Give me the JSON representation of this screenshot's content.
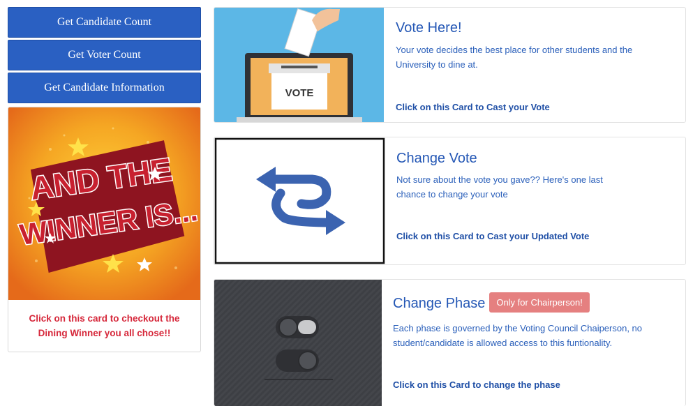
{
  "sidebar": {
    "buttons": [
      {
        "label": "Get Candidate Count"
      },
      {
        "label": "Get Voter Count"
      },
      {
        "label": "Get Candidate Information"
      }
    ],
    "winner_card": {
      "image_text": "AND THE WINNER IS...",
      "caption_line1": "Click on this card to checkout the",
      "caption_line2": "Dining Winner you all chose!!"
    }
  },
  "cards": [
    {
      "title": "Vote Here!",
      "image_label": "VOTE",
      "text_line1": "Your vote decides the best place for other students and the",
      "text_line2": "University to dine at.",
      "link": "Click on this Card to Cast your Vote"
    },
    {
      "title": "Change Vote",
      "text_line1": "Not sure about the vote you gave?? Here's one last",
      "text_line2": "chance to change your vote",
      "link": "Click on this Card to Cast your Updated Vote"
    },
    {
      "title": "Change Phase",
      "badge": "Only for Chairperson!",
      "text_line1": "Each phase is governed by the Voting Council Chaiperson, no",
      "text_line2": "student/candidate is allowed access to this funtionality.",
      "link": "Click on this Card to change the phase"
    }
  ],
  "colors": {
    "primary_button": "#2a60c2",
    "link_blue": "#2457b5",
    "winner_red": "#d6273a",
    "badge": "#e58080"
  }
}
